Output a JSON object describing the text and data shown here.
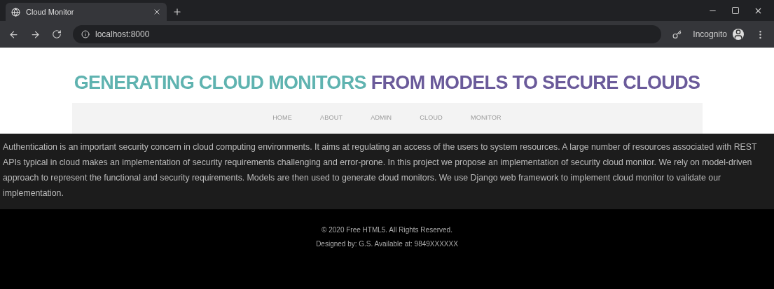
{
  "browser": {
    "tab_title": "Cloud Monitor",
    "url": "localhost:8000",
    "profile": "Incognito"
  },
  "heading": {
    "part_1": "GENERATING CLOUD MONITORS",
    "part_2": "FROM MODELS TO SECURE CLOUDS"
  },
  "nav": [
    {
      "label": "HOME"
    },
    {
      "label": "ABOUT"
    },
    {
      "label": "ADMIN"
    },
    {
      "label": "CLOUD"
    },
    {
      "label": "MONITOR"
    }
  ],
  "about": "Authentication is an important security concern in cloud computing environments. It aims at regulating an access of the users to system resources. A large number of resources associated with REST APIs typical in cloud makes an implementation of security requirements challenging and error-prone. In this project we propose an implementation of security cloud monitor. We rely on model-driven approach to represent the functional and security requirements. Models are then used to generate cloud monitors. We use Django web framework to implement cloud monitor to validate our implementation.",
  "footer": [
    "© 2020 Free HTML5. All Rights Reserved.",
    "Designed by: G.S. Available at: 9849XXXXXX"
  ]
}
